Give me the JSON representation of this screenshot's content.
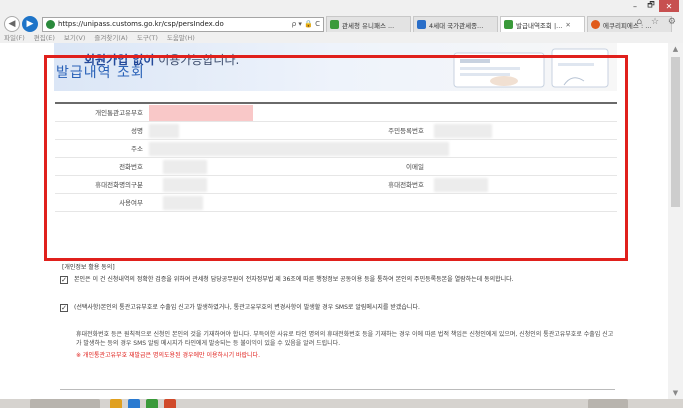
{
  "browser": {
    "url": "https://unipass.customs.go.kr/csp/persIndex.do",
    "address_icons": "ρ ▾ 🔒 C",
    "tabs": [
      {
        "label": "관세청 유니패스 ...",
        "color": "#3a9a3a",
        "active": false
      },
      {
        "label": "4세대 국가관세종...",
        "color": "#2a6ec8",
        "active": false
      },
      {
        "label": "발급내역조회 |...",
        "color": "#3a9a3a",
        "active": true
      },
      {
        "label": "에쿠리피에스 : ...",
        "color": "#e05a1a",
        "active": false
      }
    ],
    "menu": [
      "파일(F)",
      "편집(E)",
      "보기(V)",
      "즐겨찾기(A)",
      "도구(T)",
      "도움말(H)"
    ],
    "window_controls": {
      "minimize": "–",
      "maximize": "🗗",
      "close": "✕"
    },
    "right_icons": "⌂ ☆ ⚙"
  },
  "banner": {
    "bold": "회원가입 없이",
    "text": " 이용가능합니다."
  },
  "section": {
    "title": "발급내역 조회"
  },
  "form": {
    "personal_customs_code": "개인통관고유부호",
    "name": "성명",
    "resident_number": "주민등록번호",
    "address": "주소",
    "phone": "전화번호",
    "email": "이메일",
    "mobile_owner_type": "휴대전화명의구분",
    "mobile": "휴대전화번호",
    "usage": "사용여부"
  },
  "consent": {
    "title": "[개인정보 활용 동의]",
    "item1": "본인은 이 건 신청내역의 정확한 검증을 위하여 관세청 담당공무원이 전자정부법 제 36조에 따른 행정정보 공동이용 등을 통하여 본인의 주민등록등본을 열람하는데 동의합니다.",
    "item2": "(선택사항)본인의 통관고유부호로 수출입 신고가 발생하였거나, 통관고유부호의 변경사항이 발생할 경우 SMS로 알림메시지를 받겠습니다.",
    "check": "✓",
    "note": "휴대전화번호 등은 원칙적으로 신청인 본인의 것을 기재하여야 합니다. 부득이한 사유로 타인 명의의 휴대전화번호 등을 기재하는 경우 이에 따른 법적 책임은 신청인에게 있으며, 신청인의 통관고유부호로 수출입 신고가 발생하는 등의 경우 SMS 알림 메시지가 타인에게 발송되는 등 불이익이 있을 수 있음을 알려 드립니다.",
    "warning": "※ 개인통관고유부호 재발급은 명의도용된 경우에만 이용하시기 바랍니다."
  }
}
